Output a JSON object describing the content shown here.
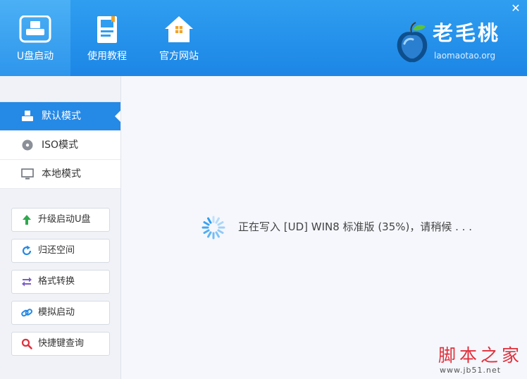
{
  "window": {
    "close_symbol": "✕",
    "close_icon": "close-icon"
  },
  "header": {
    "nav": [
      {
        "label": "U盘启动",
        "icon": "usb-drive-icon",
        "active": true
      },
      {
        "label": "使用教程",
        "icon": "book-icon",
        "active": false
      },
      {
        "label": "官方网站",
        "icon": "house-icon",
        "active": false
      }
    ],
    "logo": {
      "name": "老毛桃",
      "url": "laomaotao.org",
      "icon": "peach-logo-icon"
    }
  },
  "sidebar": {
    "modes": [
      {
        "label": "默认模式",
        "icon": "usb-mode-icon",
        "active": true
      },
      {
        "label": "ISO模式",
        "icon": "disc-icon",
        "active": false
      },
      {
        "label": "本地模式",
        "icon": "monitor-icon",
        "active": false
      }
    ],
    "actions": [
      {
        "label": "升级启动U盘",
        "icon": "arrow-up-icon",
        "color": "#2fa84f"
      },
      {
        "label": "归还空间",
        "icon": "refresh-icon",
        "color": "#2589e6"
      },
      {
        "label": "格式转换",
        "icon": "swap-icon",
        "color": "#7a5cc8"
      },
      {
        "label": "模拟启动",
        "icon": "link-icon",
        "color": "#2589e6"
      },
      {
        "label": "快捷键查询",
        "icon": "search-icon",
        "color": "#e0303c"
      }
    ]
  },
  "main": {
    "status_text": "正在写入 [UD] WIN8 标准版 (35%)，请稍候 . . ."
  },
  "watermark": {
    "text": "脚本之家",
    "url": "www.jb51.net"
  },
  "colors": {
    "header": "#1d86e6",
    "accent": "#2589e6",
    "watermark": "#e0303c"
  }
}
